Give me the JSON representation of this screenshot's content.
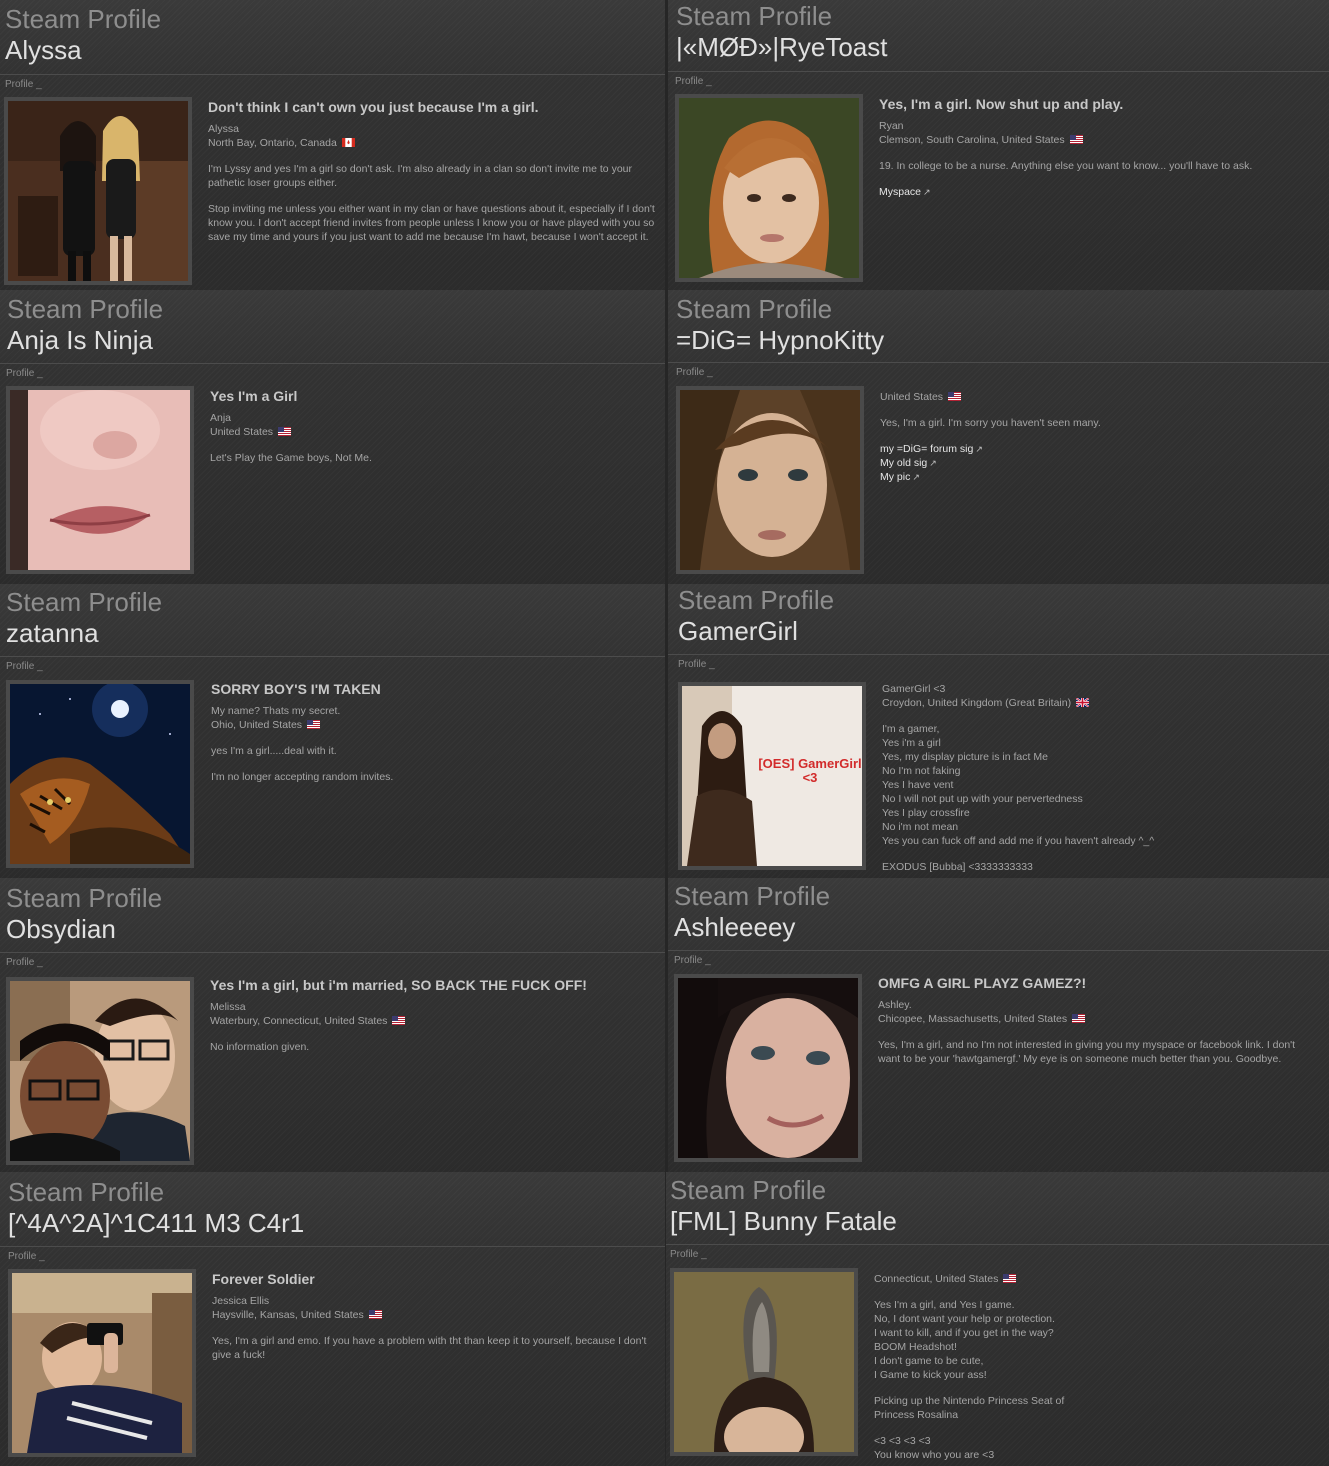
{
  "profiles": [
    {
      "steam_label": "Steam Profile",
      "name": "Alyssa",
      "profile_label": "Profile _",
      "headline": "Don't think I can't own you just because I'm a girl.",
      "real_name": "Alyssa",
      "location": "North Bay, Ontario, Canada",
      "flag": "canada-flag-icon",
      "summary_1": "I'm Lyssy and yes I'm a girl so don't ask. I'm also already in a clan so don't invite me to your pathetic loser groups either.",
      "summary_2": "Stop inviting me unless you either want in my clan or have questions about it, especially if I don't know you. I don't accept friend invites from people unless I know you or have played with you so save my time and yours if you just want to add me because I'm hawt, because I won't accept it."
    },
    {
      "steam_label": "Steam Profile",
      "name": "|«MØÐ»|RyeToast",
      "profile_label": "Profile _",
      "headline": "Yes, I'm a girl. Now shut up and play.",
      "real_name": "Ryan",
      "location": "Clemson, South Carolina, United States",
      "flag": "usa-flag-icon",
      "summary_1": "19. In college to be a nurse. Anything else you want to know... you'll have to ask.",
      "link_1": "Myspace"
    },
    {
      "steam_label": "Steam Profile",
      "name": "Anja Is Ninja",
      "profile_label": "Profile _",
      "headline": "Yes I'm a Girl",
      "real_name": "Anja",
      "location": "United States",
      "flag": "usa-flag-icon",
      "summary_1": "Let's Play the Game boys, Not Me."
    },
    {
      "steam_label": "Steam Profile",
      "name": "=DiG= HypnoKitty",
      "profile_label": "Profile _",
      "location": "United States",
      "flag": "usa-flag-icon",
      "summary_1": "Yes, I'm a girl. I'm sorry you haven't seen many.",
      "link_1": "my =DiG= forum sig",
      "link_2": "My old sig",
      "link_3": "My pic"
    },
    {
      "steam_label": "Steam Profile",
      "name": "zatanna",
      "profile_label": "Profile _",
      "headline": "SORRY BOY'S I'M TAKEN",
      "real_name": "My name? Thats my secret.",
      "location": "Ohio, United States",
      "flag": "usa-flag-icon",
      "summary_1": "yes I'm a girl.....deal with it.",
      "summary_2": "I'm no longer accepting random invites."
    },
    {
      "steam_label": "Steam Profile",
      "name": "GamerGirl",
      "profile_label": "Profile _",
      "real_name": "GamerGirl <3",
      "location": "Croydon, United Kingdom (Great Britain)",
      "flag": "uk-flag-icon",
      "avatar_text_1": "[OES] GamerGirl",
      "avatar_text_2": "<3",
      "lines": [
        "I'm a gamer,",
        "Yes i'm a girl",
        "Yes, my display picture is in fact Me",
        "No I'm not faking",
        "Yes I have vent",
        "No I will not put up with your pervertedness",
        "Yes I play crossfire",
        "No i'm not mean",
        "Yes you can fuck off and add me if you haven't already ^_^"
      ],
      "footer": "EXODUS [Bubba] <3333333333"
    },
    {
      "steam_label": "Steam Profile",
      "name": "Obsydian",
      "profile_label": "Profile _",
      "headline": "Yes I'm a girl, but i'm married, SO BACK THE FUCK OFF!",
      "real_name": "Melissa",
      "location": "Waterbury, Connecticut, United States",
      "flag": "usa-flag-icon",
      "summary_1": "No information given."
    },
    {
      "steam_label": "Steam Profile",
      "name": "Ashleeeey",
      "profile_label": "Profile _",
      "headline": "OMFG A GIRL PLAYZ GAMEZ?!",
      "real_name": "Ashley.",
      "location": "Chicopee, Massachusetts, United States",
      "flag": "usa-flag-icon",
      "summary_1": "Yes, I'm a girl, and no I'm not interested in giving you my myspace or facebook link. I don't want to be your 'hawtgamergf.' My eye is on someone much better than you. Goodbye."
    },
    {
      "steam_label": "Steam Profile",
      "name": "[^4A^2A]^1C411 M3 C4r1",
      "profile_label": "Profile _",
      "headline": "Forever Soldier",
      "real_name": "Jessica Ellis",
      "location": "Haysville, Kansas, United States",
      "flag": "usa-flag-icon",
      "summary_1": "Yes, I'm a girl and emo. If you have a problem with tht than keep it to yourself, because I don't give a fuck!"
    },
    {
      "steam_label": "Steam Profile",
      "name": "[FML] Bunny Fatale",
      "profile_label": "Profile _",
      "location": "Connecticut, United States",
      "flag": "usa-flag-icon",
      "lines_a": [
        "Yes I'm a girl, and Yes I game.",
        "No, I dont want your help or protection.",
        "I want to kill, and if you get in the way?",
        "BOOM Headshot!",
        "I don't game to be cute,",
        "I Game to kick your ass!"
      ],
      "lines_b": [
        "Picking up the Nintendo Princess Seat of",
        "Princess Rosalina"
      ],
      "lines_c": [
        "<3 <3 <3 <3",
        "You know who you are <3"
      ]
    }
  ],
  "colors": {
    "background": "#262626",
    "text": "#a5a5a5",
    "headline": "#c8c8c8",
    "name": "#e0e0e0",
    "steam_label": "#8e8e8e"
  }
}
